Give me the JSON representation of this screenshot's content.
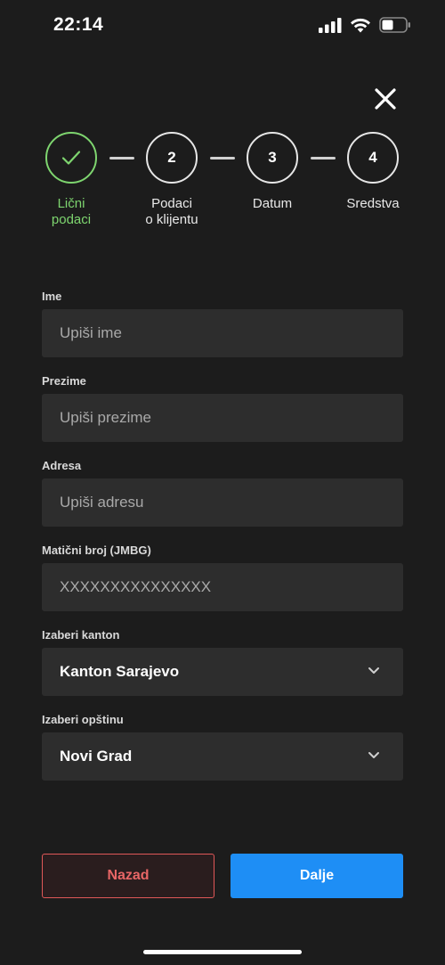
{
  "status": {
    "time": "22:14"
  },
  "stepper": {
    "steps": [
      {
        "number": "",
        "label_line1": "Lični",
        "label_line2": "podaci",
        "done": true
      },
      {
        "number": "2",
        "label_line1": "Podaci",
        "label_line2": "o klijentu",
        "done": false
      },
      {
        "number": "3",
        "label_line1": "Datum",
        "label_line2": "",
        "done": false
      },
      {
        "number": "4",
        "label_line1": "Sredstva",
        "label_line2": "",
        "done": false
      }
    ]
  },
  "form": {
    "first_name": {
      "label": "Ime",
      "placeholder": "Upiši ime"
    },
    "last_name": {
      "label": "Prezime",
      "placeholder": "Upiši prezime"
    },
    "address": {
      "label": "Adresa",
      "placeholder": "Upiši adresu"
    },
    "jmbg": {
      "label": "Matični broj (JMBG)",
      "placeholder": "XXXXXXXXXXXXXXX"
    },
    "canton": {
      "label": "Izaberi kanton",
      "value": "Kanton Sarajevo"
    },
    "municipality": {
      "label": "Izaberi opštinu",
      "value": "Novi Grad"
    }
  },
  "actions": {
    "back_label": "Nazad",
    "next_label": "Dalje"
  },
  "colors": {
    "background": "#1c1c1c",
    "input_bg": "#2d2d2d",
    "success": "#7ed56f",
    "primary": "#1e8ef5",
    "danger": "#e05858"
  },
  "icons": {
    "close": "close-icon",
    "check": "check-icon",
    "chevron": "chevron-down-icon",
    "signal": "cellular-signal-icon",
    "wifi": "wifi-icon",
    "battery": "battery-icon"
  }
}
